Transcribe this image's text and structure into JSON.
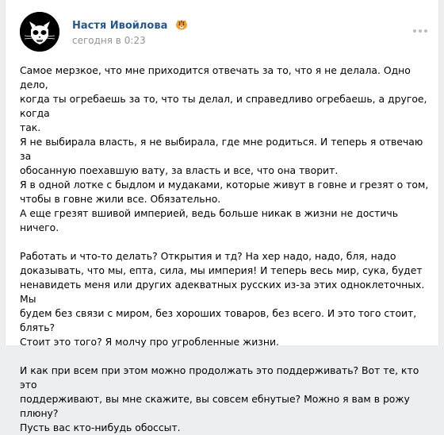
{
  "post": {
    "author": "Настя Ивойлова",
    "badge_icon": "tiger-emoji",
    "time": "сегодня в 0:23",
    "more_icon": "more-dots-icon",
    "paragraphs": [
      "Самое мерзкое, что мне приходится отвечать за то, что я не делала. Одно дело,\nкогда ты огребаешь за то, что ты делал, и справедливо огребаешь, а другое, когда\nтак.\nЯ не выбирала власть, я не выбирала, где мне родиться. И теперь я отвечаю за\nобосанную поехавшую вату, за власть и все, что она творит.\nЯ в одной лотке с быдлом и мудаками, которые живут в говне и грезят о том,\nчтобы в говне жили все. Обязательно.\nА еще грезят вшивой империей, ведь больше никак в жизни не достичь ничего.",
      "Работать и что-то делать? Открытия и тд? На хер надо, надо, бля, надо\nдоказывать, что мы, епта, сила, мы империя! И теперь весь мир, сука, будет\nненавидеть меня или других адекватных русских из-за этих одноклеточных. Мы\nбудем без связи с миром, без хороших товаров, без всего. И это того стоит, блять?\nСтоит это того? Я молчу про угробленные жизни.",
      "И как при всем при этом можно продолжать это поддерживать? Вот те, кто это\nподдерживают, вы мне скажите, вы совсем ебнутые? Можно я вам в рожу плюну?\nПусть вас кто-нибудь обоссыт."
    ]
  }
}
